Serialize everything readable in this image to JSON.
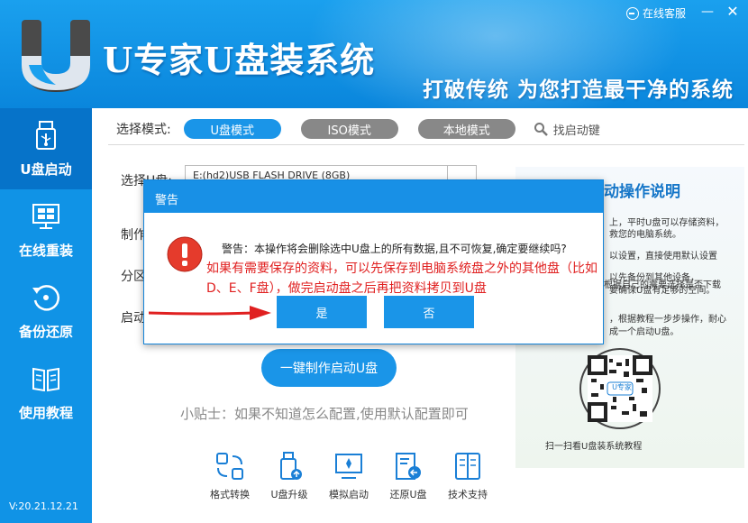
{
  "header": {
    "app_title": "U专家U盘装系统",
    "slogan": "打破传统  为您打造最干净的系统",
    "online_service": "在线客服",
    "minimize": "—",
    "close": "✕"
  },
  "sidebar": {
    "items": [
      {
        "label": "U盘启动",
        "icon": "usb-drive-icon"
      },
      {
        "label": "在线重装",
        "icon": "windows-icon"
      },
      {
        "label": "备份还原",
        "icon": "restore-icon"
      },
      {
        "label": "使用教程",
        "icon": "book-icon"
      }
    ],
    "version": "V:20.21.12.21"
  },
  "mode": {
    "label": "选择模式:",
    "options": [
      "U盘模式",
      "ISO模式",
      "本地模式"
    ],
    "selected": "U盘模式",
    "find_key": "找启动键"
  },
  "form": {
    "select_usb_label": "选择U盘:",
    "usb_value": "E:(hd2)USB FLASH DRIVE (8GB)",
    "row2_label": "制作",
    "row3_label": "分区",
    "row4_label": "启动"
  },
  "main": {
    "make_button": "一键制作启动U盘",
    "tip": "小贴士：如果不知道怎么配置,使用默认配置即可"
  },
  "tools": [
    {
      "label": "格式转换",
      "icon": "format-convert-icon"
    },
    {
      "label": "U盘升级",
      "icon": "usb-upgrade-icon"
    },
    {
      "label": "模拟启动",
      "icon": "simulate-boot-icon"
    },
    {
      "label": "还原U盘",
      "icon": "restore-usb-icon"
    },
    {
      "label": "技术支持",
      "icon": "support-book-icon"
    }
  ],
  "right_panel": {
    "title": "动操作说明",
    "line1": "上，平时U盘可以存储资料，",
    "line2": "救您的电脑系统。",
    "line3": "以设置，直接使用默认设置",
    "line4": "以先备份到其他设备，",
    "line5": "要确保U盘有足够的空间。",
    "line6": "根据自己的需要选择是否下载",
    "line7": "，根据教程一步步操作，耐心",
    "line8": "成一个启动U盘。",
    "qr_caption": "扫一扫看U盘装系统教程",
    "qr_text": "U专家"
  },
  "dialog": {
    "title": "警告",
    "message": "警告：本操作将会删除选中U盘上的所有数据,且不可恢复,确定要继续吗?",
    "red_text": "如果有需要保存的资料，可以先保存到电脑系统盘之外的其他盘（比如D、E、F盘），做完启动盘之后再把资料拷贝到U盘",
    "yes": "是",
    "no": "否"
  }
}
